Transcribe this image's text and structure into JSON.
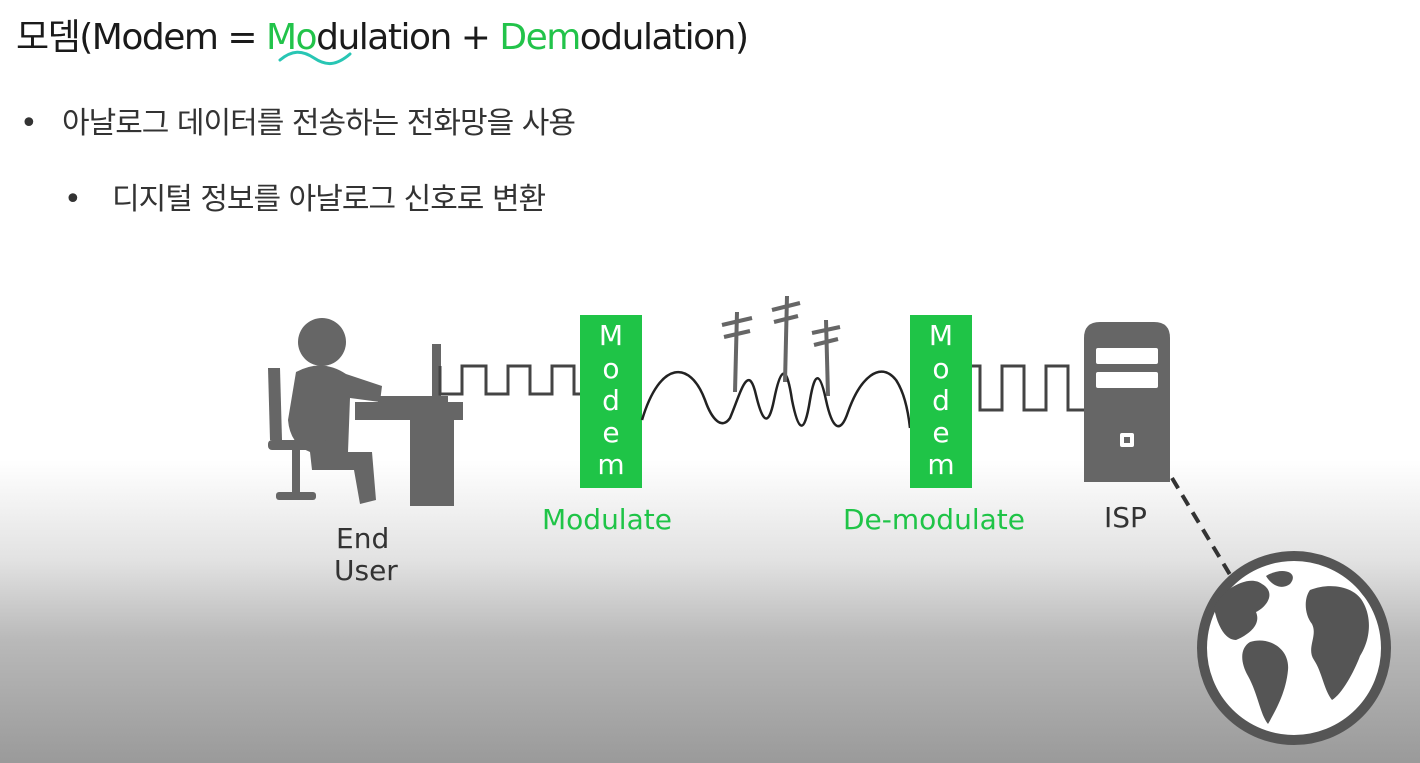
{
  "title": {
    "prefix": "모뎀(Modem = ",
    "mo": "Mo",
    "after_mo": "dulation + ",
    "dem": "Dem",
    "suffix": "odulation)"
  },
  "bullets": [
    "아날로그 데이터를 전송하는 전화망을 사용",
    "디지털 정보를 아날로그 신호로 변환"
  ],
  "diagram": {
    "modem_letters": [
      "M",
      "o",
      "d",
      "e",
      "m"
    ],
    "end_user_line1": "End",
    "end_user_line2": "User",
    "modulate": "Modulate",
    "demodulate": "De-modulate",
    "isp": "ISP"
  },
  "colors": {
    "accent_green": "#22c34a",
    "icon_gray": "#666666"
  },
  "icons": [
    "person-at-desk-icon",
    "utility-pole-icon",
    "server-icon",
    "globe-icon"
  ]
}
